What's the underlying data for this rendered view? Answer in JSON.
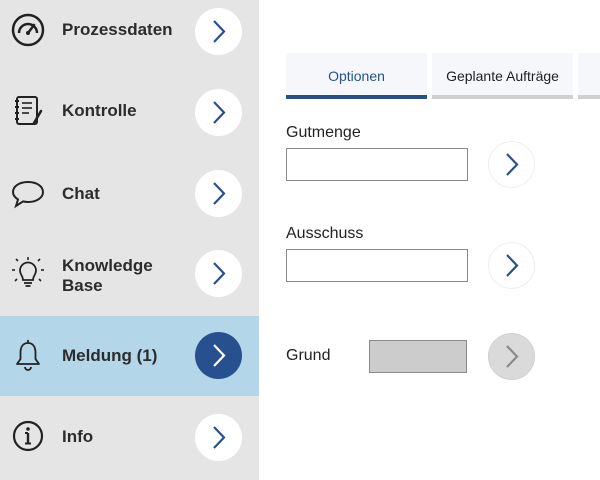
{
  "sidebar": {
    "items": [
      {
        "id": "prozessdaten",
        "label_lines": [
          "Prozessdaten"
        ],
        "icon": "gauge-icon",
        "active": false
      },
      {
        "id": "kontrolle",
        "label_lines": [
          "Kontrolle"
        ],
        "icon": "checklist-icon",
        "active": false
      },
      {
        "id": "chat",
        "label_lines": [
          "Chat"
        ],
        "icon": "chat-bubble-icon",
        "active": false
      },
      {
        "id": "knowledge-base",
        "label_lines": [
          "Knowledge",
          "Base"
        ],
        "icon": "lightbulb-icon",
        "active": false
      },
      {
        "id": "meldung",
        "label_lines": [
          "Meldung (1)"
        ],
        "icon": "bell-icon",
        "active": true
      },
      {
        "id": "info",
        "label_lines": [
          "Info"
        ],
        "icon": "info-icon",
        "active": false
      }
    ]
  },
  "tabs": [
    {
      "label": "Optionen",
      "active": true
    },
    {
      "label": "Geplante Aufträge",
      "active": false
    },
    {
      "label": "",
      "active": false
    }
  ],
  "form": {
    "gutmenge": {
      "label": "Gutmenge",
      "value": "",
      "placeholder": ""
    },
    "ausschuss": {
      "label": "Ausschuss",
      "value": "",
      "placeholder": ""
    },
    "grund": {
      "label": "Grund",
      "value": "",
      "disabled": true
    }
  },
  "colors": {
    "accent": "#27508f",
    "sidebar_bg": "#e5e5e5",
    "active_bg": "#b4d6e9",
    "tab_bg": "#f5f7fb",
    "disabled_field": "#cccccc"
  }
}
